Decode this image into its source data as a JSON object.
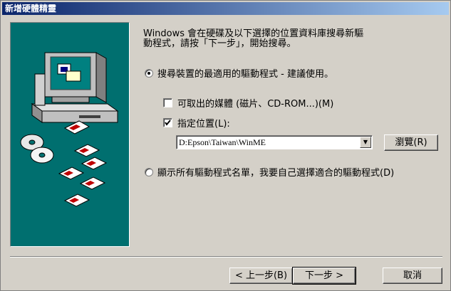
{
  "window": {
    "title": "新增硬體精靈"
  },
  "instruction": "Windows 會在硬碟及以下選擇的位置資料庫搜尋新驅\n動程式，請按「下一步」，開始搜尋。",
  "options": {
    "search_best": {
      "label": "搜尋裝置的最適用的驅動程式 - 建議使用。",
      "checked": true
    },
    "removable_media": {
      "label": "可取出的媒體 (磁片、CD-ROM...)(M)",
      "checked": false
    },
    "specify_location": {
      "label": "指定位置(L):",
      "checked": true
    },
    "location_value": "D:Epson\\Taiwan\\WinME",
    "display_list": {
      "label": "顯示所有驅動程式名單，我要自己選擇適合的驅動程式(D)",
      "checked": false
    }
  },
  "buttons": {
    "browse": "瀏覽(R)",
    "back": "< 上一步(B)",
    "next": "下一步 >",
    "cancel": "取消"
  },
  "colors": {
    "title_start": "#0a246a",
    "title_end": "#a6caf0",
    "art_bg": "#006f6f",
    "face": "#d4d0c8"
  },
  "icons": [
    "computer-icon",
    "cd-disc-icon",
    "floppy-disk-icon"
  ]
}
